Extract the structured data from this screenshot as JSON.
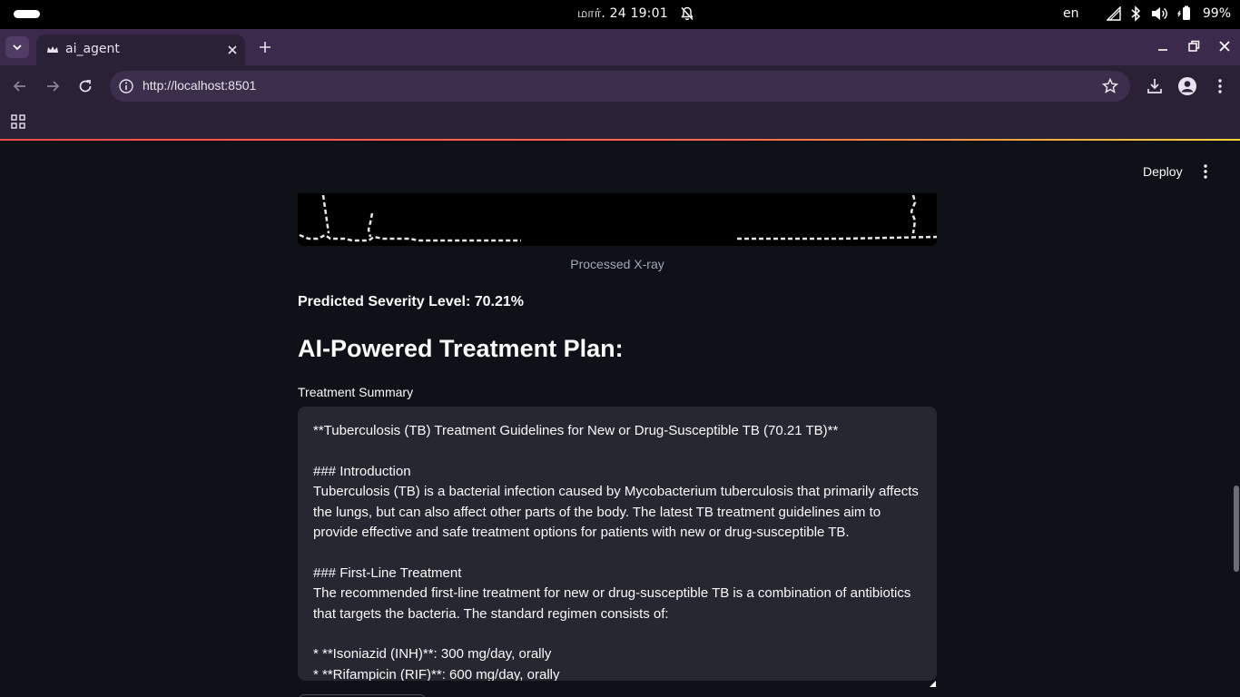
{
  "os": {
    "clock": "மார். 24  19:01",
    "lang": "en",
    "battery": "99%"
  },
  "browser": {
    "tab_title": "ai_agent",
    "url": "http://localhost:8501"
  },
  "app": {
    "deploy_label": "Deploy",
    "image_caption": "Processed X-ray",
    "severity_text": "Predicted Severity Level: 70.21%",
    "plan_heading": "AI-Powered Treatment Plan:",
    "textarea_label": "Treatment Summary",
    "textarea_value": "**Tuberculosis (TB) Treatment Guidelines for New or Drug-Susceptible TB (70.21 TB)**\n\n### Introduction\nTuberculosis (TB) is a bacterial infection caused by Mycobacterium tuberculosis that primarily affects the lungs, but can also affect other parts of the body. The latest TB treatment guidelines aim to provide effective and safe treatment options for patients with new or drug-susceptible TB.\n\n### First-Line Treatment\nThe recommended first-line treatment for new or drug-susceptible TB is a combination of antibiotics that targets the bacteria. The standard regimen consists of:\n\n* **Isoniazid (INH)**: 300 mg/day, orally\n* **Rifampicin (RIF)**: 600 mg/day, orally"
  },
  "icons": [
    "bell-off-icon",
    "signal-icon",
    "bluetooth-icon",
    "volume-icon",
    "battery-icon",
    "tab-list-icon",
    "favicon-icon",
    "close-icon",
    "plus-icon",
    "minimize-icon",
    "maximize-icon",
    "back-icon",
    "forward-icon",
    "reload-icon",
    "info-icon",
    "star-icon",
    "download-icon",
    "profile-icon",
    "menu-icon",
    "apps-icon",
    "kebab-icon"
  ]
}
